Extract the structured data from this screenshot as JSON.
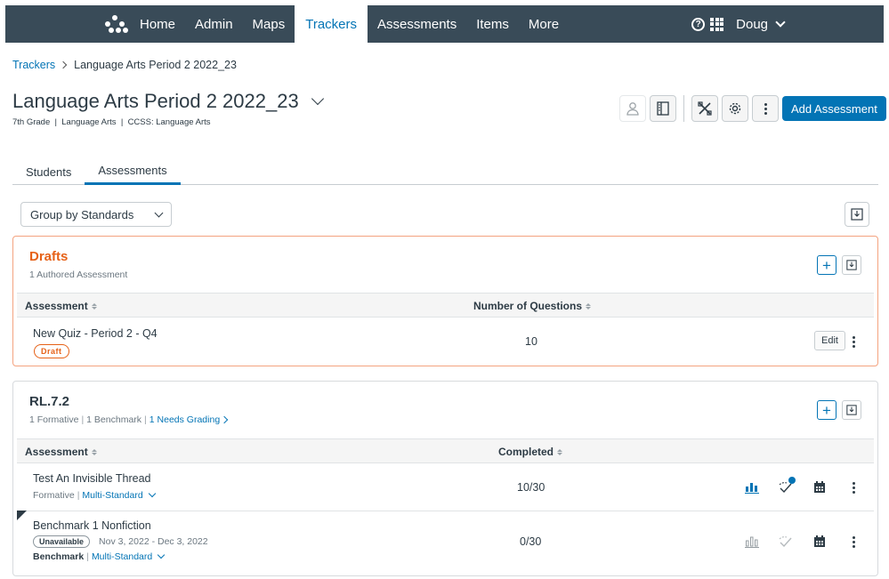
{
  "nav": {
    "items": [
      "Home",
      "Admin",
      "Maps",
      "Trackers",
      "Assessments",
      "Items",
      "More"
    ],
    "active": "Trackers",
    "user": "Doug",
    "help_glyph": "?"
  },
  "breadcrumb": {
    "parent": "Trackers",
    "current": "Language Arts Period 2 2022_23"
  },
  "page": {
    "title": "Language Arts Period 2 2022_23",
    "meta": "7th Grade  |  Language Arts  |  CCSS: Language Arts"
  },
  "toolbar": {
    "add_label": "Add Assessment"
  },
  "tabs": [
    "Students",
    "Assessments"
  ],
  "group_select": {
    "value": "Group by Standards"
  },
  "drafts": {
    "title": "Drafts",
    "subtitle": "1 Authored Assessment",
    "col_assessment": "Assessment",
    "col_questions": "Number of Questions",
    "row": {
      "name": "New Quiz - Period 2 - Q4",
      "badge": "Draft",
      "questions": "10",
      "edit": "Edit"
    }
  },
  "standard": {
    "title": "RL.7.2",
    "formative": "1 Formative",
    "benchmark": "1 Benchmark",
    "needs_grading": "1 Needs Grading",
    "col_assessment": "Assessment",
    "col_completed": "Completed",
    "rows": [
      {
        "name": "Test An Invisible Thread",
        "type": "Formative",
        "standard": "Multi-Standard",
        "completed": "10/30"
      },
      {
        "name": "Benchmark 1 Nonfiction",
        "status": "Unavailable",
        "dates": "Nov 3, 2022 - Dec 3, 2022",
        "type": "Benchmark",
        "standard": "Multi-Standard",
        "completed": "0/30"
      }
    ]
  },
  "colors": {
    "nav_bg": "#394b58",
    "accent": "#0374b5",
    "draft": "#e66117"
  }
}
